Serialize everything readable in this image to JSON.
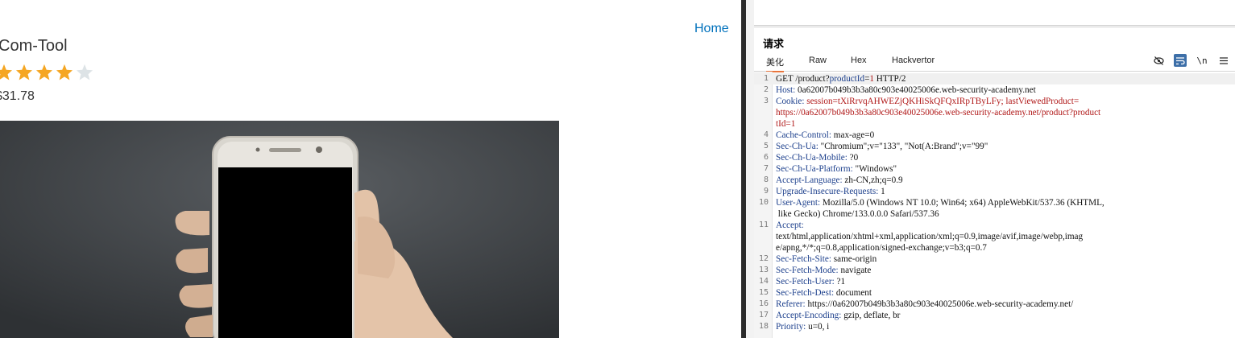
{
  "product_page": {
    "nav": {
      "home_label": "Home"
    },
    "title": "Com-Tool",
    "rating": 4,
    "max_rating": 5,
    "price": "$31.78",
    "star_colors": {
      "filled": "#f5a623",
      "empty": "#dde3e6"
    }
  },
  "request_panel": {
    "title": "请求",
    "tabs": [
      "美化",
      "Raw",
      "Hex",
      "Hackvertor"
    ],
    "active_tab": "美化",
    "tool_icons": [
      "eye-off-icon",
      "wrap-lines-icon",
      "newline-icon",
      "menu-icon"
    ],
    "lines": [
      {
        "num": "1",
        "name": "",
        "value": "GET /product?productId=1 HTTP/2"
      },
      {
        "num": "2",
        "name": "Host:",
        "value": "0a62007b049b3b3a80c903e40025006e.web-security-academy.net"
      },
      {
        "num": "3",
        "name": "Cookie:",
        "value": "session=tXiRrvqAHWEZjQKHiSkQFQxIRpTByLFy; lastViewedProduct="
      },
      {
        "num": "",
        "name": "",
        "value": "https://0a62007b049b3b3a80c903e40025006e.web-security-academy.net/product?product"
      },
      {
        "num": "",
        "name": "",
        "value": "tId=1"
      },
      {
        "num": "4",
        "name": "Cache-Control:",
        "value": "max-age=0"
      },
      {
        "num": "5",
        "name": "Sec-Ch-Ua:",
        "value": "\"Chromium\";v=\"133\", \"Not(A:Brand\";v=\"99\""
      },
      {
        "num": "6",
        "name": "Sec-Ch-Ua-Mobile:",
        "value": "?0"
      },
      {
        "num": "7",
        "name": "Sec-Ch-Ua-Platform:",
        "value": "\"Windows\""
      },
      {
        "num": "8",
        "name": "Accept-Language:",
        "value": "zh-CN,zh;q=0.9"
      },
      {
        "num": "9",
        "name": "Upgrade-Insecure-Requests:",
        "value": "1"
      },
      {
        "num": "10",
        "name": "User-Agent:",
        "value": "Mozilla/5.0 (Windows NT 10.0; Win64; x64) AppleWebKit/537.36 (KHTML,"
      },
      {
        "num": "",
        "name": "",
        "value": " like Gecko) Chrome/133.0.0.0 Safari/537.36"
      },
      {
        "num": "11",
        "name": "Accept:",
        "value": ""
      },
      {
        "num": "",
        "name": "",
        "value": "text/html,application/xhtml+xml,application/xml;q=0.9,image/avif,image/webp,imag"
      },
      {
        "num": "",
        "name": "",
        "value": "e/apng,*/*;q=0.8,application/signed-exchange;v=b3;q=0.7"
      },
      {
        "num": "12",
        "name": "Sec-Fetch-Site:",
        "value": "same-origin"
      },
      {
        "num": "13",
        "name": "Sec-Fetch-Mode:",
        "value": "navigate"
      },
      {
        "num": "14",
        "name": "Sec-Fetch-User:",
        "value": "?1"
      },
      {
        "num": "15",
        "name": "Sec-Fetch-Dest:",
        "value": "document"
      },
      {
        "num": "16",
        "name": "Referer:",
        "value": "https://0a62007b049b3b3a80c903e40025006e.web-security-academy.net/"
      },
      {
        "num": "17",
        "name": "Accept-Encoding:",
        "value": "gzip, deflate, br"
      },
      {
        "num": "18",
        "name": "Priority:",
        "value": "u=0, i"
      }
    ]
  }
}
